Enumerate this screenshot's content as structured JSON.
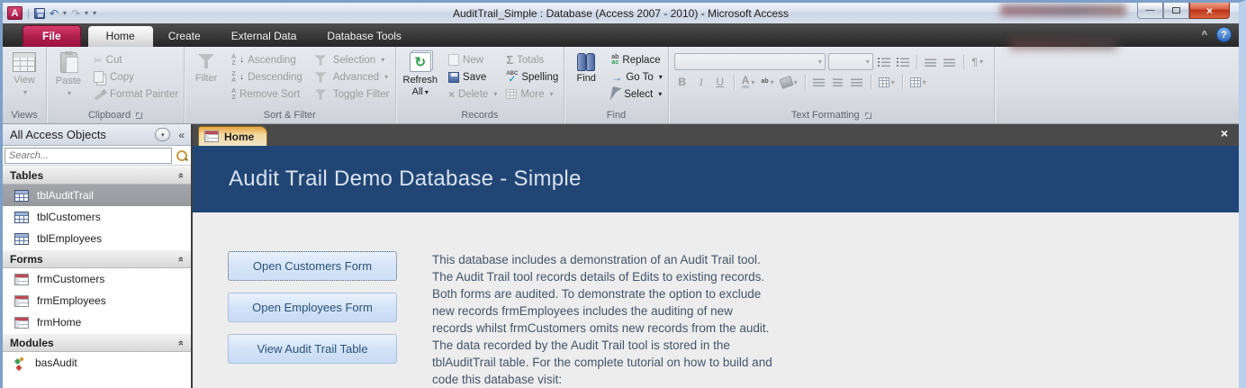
{
  "titlebar": {
    "title": "AuditTrail_Simple : Database (Access 2007 - 2010)  -  Microsoft Access",
    "app_letter": "A"
  },
  "ribbon_tabs": {
    "file": "File",
    "home": "Home",
    "create": "Create",
    "external_data": "External Data",
    "database_tools": "Database Tools"
  },
  "ribbon": {
    "views": {
      "group": "Views",
      "view": "View"
    },
    "clipboard": {
      "group": "Clipboard",
      "paste": "Paste",
      "cut": "Cut",
      "copy": "Copy",
      "format_painter": "Format Painter"
    },
    "sort_filter": {
      "group": "Sort & Filter",
      "filter": "Filter",
      "ascending": "Ascending",
      "descending": "Descending",
      "remove_sort": "Remove Sort",
      "selection": "Selection",
      "advanced": "Advanced",
      "toggle_filter": "Toggle Filter"
    },
    "records": {
      "group": "Records",
      "refresh": "Refresh",
      "all": "All",
      "new": "New",
      "save": "Save",
      "delete": "Delete",
      "totals": "Totals",
      "spelling": "Spelling",
      "more": "More"
    },
    "find": {
      "group": "Find",
      "find": "Find",
      "replace": "Replace",
      "go_to": "Go To",
      "select": "Select"
    },
    "text_formatting": {
      "group": "Text Formatting",
      "bold": "B",
      "italic": "I",
      "underline": "U",
      "font_color": "A"
    }
  },
  "nav_pane": {
    "title": "All Access Objects",
    "search_placeholder": "Search...",
    "sections": [
      {
        "label": "Tables",
        "items": [
          {
            "label": "tblAuditTrail"
          },
          {
            "label": "tblCustomers"
          },
          {
            "label": "tblEmployees"
          }
        ]
      },
      {
        "label": "Forms",
        "items": [
          {
            "label": "frmCustomers"
          },
          {
            "label": "frmEmployees"
          },
          {
            "label": "frmHome"
          }
        ]
      },
      {
        "label": "Modules",
        "items": [
          {
            "label": "basAudit"
          }
        ]
      }
    ]
  },
  "main": {
    "doc_tab": "Home",
    "banner_title": "Audit Trail Demo Database - Simple",
    "buttons": [
      {
        "label": "Open Customers Form"
      },
      {
        "label": "Open Employees Form"
      },
      {
        "label": "View Audit Trail Table"
      }
    ],
    "description": "This database includes a demonstration of an Audit Trail tool. The Audit Trail tool records details of Edits to existing records. Both forms are audited. To demonstrate the option to exclude new records frmEmployees includes the auditing of new records whilst frmCustomers omits new records from the audit. The data recorded by the Audit Trail tool is stored in the tblAuditTrail table. For the complete tutorial on how to build and code this database visit:"
  },
  "icons": {
    "dropdown": "▾",
    "scissors": "✂",
    "sigma": "Σ",
    "refresh": "↻",
    "undo": "↶",
    "redo": "↷",
    "check": "✓",
    "pilcrow": "¶",
    "goto_arrow": "→",
    "sort_down": "↓",
    "chevron_double": "»",
    "collapse_pane": "«",
    "minimize": "—",
    "close": "×",
    "help": "?",
    "ribbon_collapse": "^",
    "replace_top": "ab",
    "replace_bottom": "ac",
    "az_a": "A",
    "az_z": "Z",
    "abc": "ABC"
  },
  "colors": {
    "banner_blue": "#214676",
    "file_tab_red": "#B01E4E",
    "button_text": "#2A5277",
    "description_text": "#44546A",
    "selected_item_gray": "#9A9DA1"
  }
}
